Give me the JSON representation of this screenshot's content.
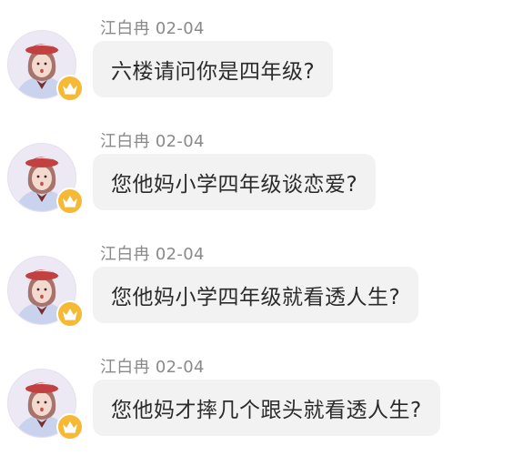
{
  "messages": [
    {
      "sender": "江白冉",
      "date": "02-04",
      "text": "六楼请问你是四年级?"
    },
    {
      "sender": "江白冉",
      "date": "02-04",
      "text": "您他妈小学四年级谈恋爱?"
    },
    {
      "sender": "江白冉",
      "date": "02-04",
      "text": "您他妈小学四年级就看透人生?"
    },
    {
      "sender": "江白冉",
      "date": "02-04",
      "text": "您他妈才摔几个跟头就看透人生?"
    }
  ],
  "colors": {
    "bubble": "#f2f2f2",
    "meta_text": "#8a8a8a",
    "message_text": "#2b2b2b",
    "badge": "#f5b935"
  },
  "icons": {
    "avatar": "user-avatar",
    "badge": "crown-icon"
  }
}
